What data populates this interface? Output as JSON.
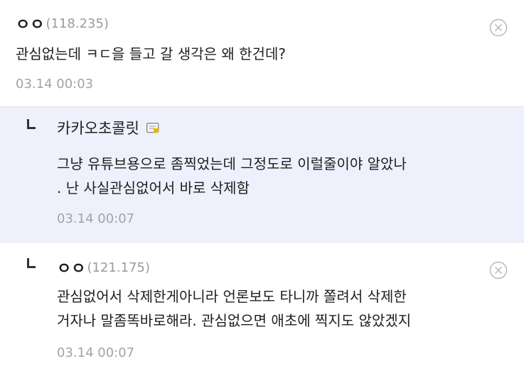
{
  "comments": [
    {
      "nick": "ㅇㅇ",
      "ip": "(118.235)",
      "text": "관심없는데 ㅋㄷ을 들고 갈 생각은 왜 한건데?",
      "time": "03.14 00:03",
      "has_delete": true,
      "icon": "close-circle-icon"
    },
    {
      "nick": "카카오초콜릿",
      "ip": "",
      "text": "그냥 유튜브용으로 좀찍었는데 그정도로 이럴줄이야 알았나\n. 난 사실관심없어서 바로 삭제함",
      "time": "03.14 00:07",
      "badge_icon": "fixed-nick-badge-icon"
    },
    {
      "nick": "ㅇㅇ",
      "ip": "(121.175)",
      "text": "관심없어서 삭제한게아니라 언론보도 타니까 쫄려서 삭제한\n거자나 말좀똑바로해라. 관심없으면 애초에 찍지도 않았겠지",
      "time": "03.14 00:07",
      "has_delete": true,
      "icon": "close-circle-icon"
    }
  ],
  "colors": {
    "reply_bg": "#eef1fb",
    "time": "#a3a3a3",
    "ip": "#9b9b9b"
  }
}
